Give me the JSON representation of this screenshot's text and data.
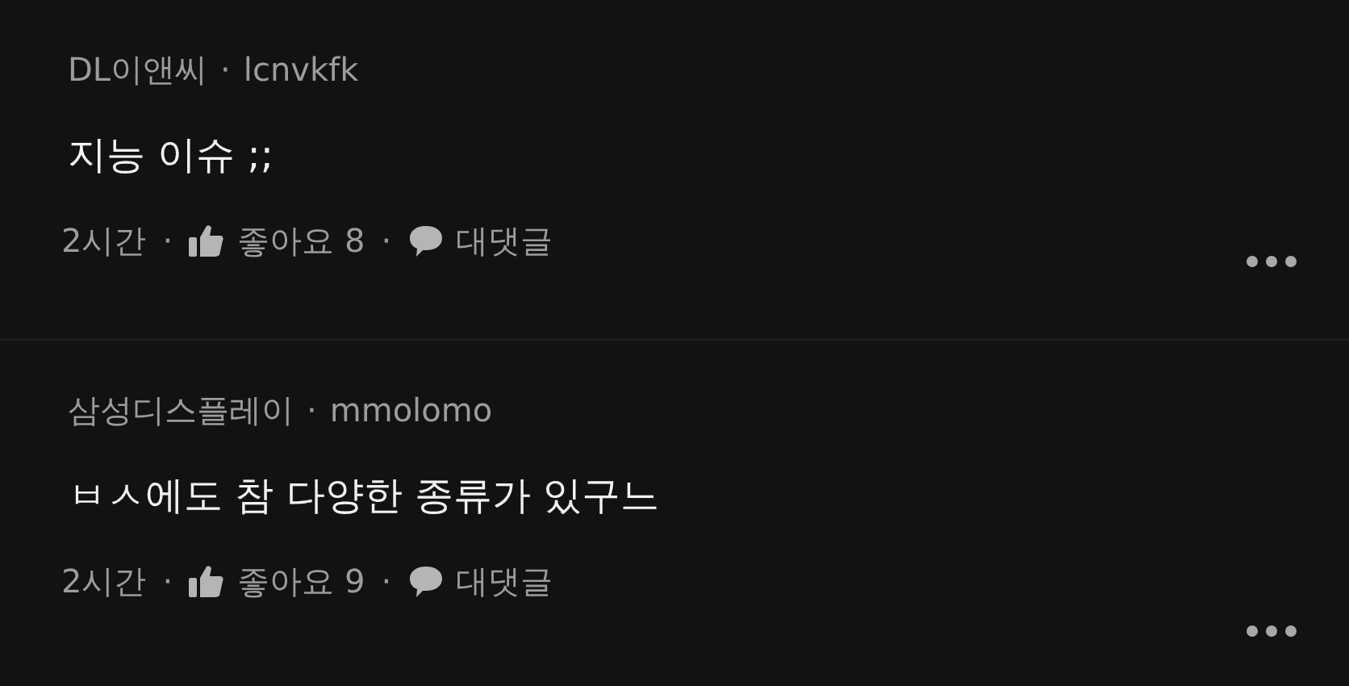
{
  "comments": [
    {
      "affiliation": "DL이앤씨",
      "separator": "·",
      "nickname": "lcnvkfk",
      "body": "지능 이슈 ;;",
      "time": "2시간",
      "meta_separators": [
        "·",
        "·"
      ],
      "likes": "좋아요 8",
      "reply": "대댓글"
    },
    {
      "affiliation": "삼성디스플레이",
      "separator": "·",
      "nickname": "mmolomo",
      "body": "ㅂㅅ에도 참 다양한 종류가 있구느",
      "time": "2시간",
      "meta_separators": [
        "·",
        "·"
      ],
      "likes": "좋아요 9",
      "reply": "대댓글"
    }
  ]
}
